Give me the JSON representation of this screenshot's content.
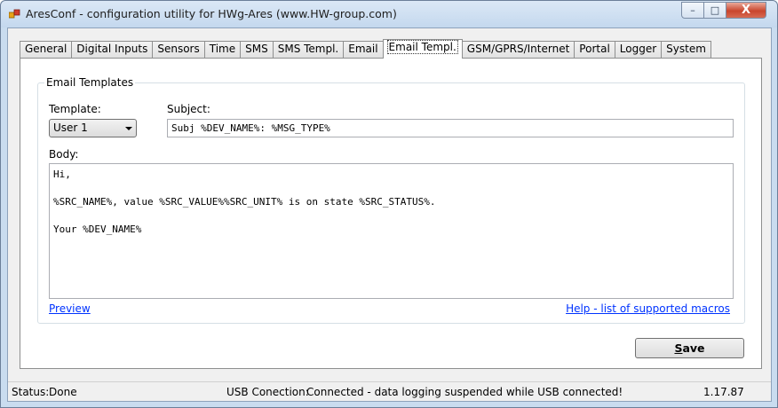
{
  "window": {
    "title": "AresConf - configuration utility for HWg-Ares (www.HW-group.com)",
    "controls": {
      "minimize": "–",
      "maximize": "□",
      "close": "X"
    }
  },
  "tabs": [
    {
      "label": "General"
    },
    {
      "label": "Digital Inputs"
    },
    {
      "label": "Sensors"
    },
    {
      "label": "Time"
    },
    {
      "label": "SMS"
    },
    {
      "label": "SMS Templ."
    },
    {
      "label": "Email"
    },
    {
      "label": "Email Templ.",
      "active": true
    },
    {
      "label": "GSM/GPRS/Internet"
    },
    {
      "label": "Portal"
    },
    {
      "label": "Logger"
    },
    {
      "label": "System"
    }
  ],
  "group": {
    "title": "Email Templates",
    "template_label": "Template:",
    "template_value": "User 1",
    "subject_label": "Subject:",
    "subject_value": "Subj %DEV_NAME%: %MSG_TYPE%",
    "body_label": "Body:",
    "body_value": "Hi,\n\n%SRC_NAME%, value %SRC_VALUE%%SRC_UNIT% is on state %SRC_STATUS%.\n\nYour %DEV_NAME%",
    "preview_link": "Preview",
    "help_link": "Help - list of supported macros"
  },
  "save_button": {
    "label_prefix": "",
    "label_underlined": "S",
    "label_rest": "ave"
  },
  "statusbar": {
    "status_label": "Status:",
    "status_value": "Done",
    "usb_label": "USB Conection:",
    "usb_value": "Connected - data logging suspended while USB connected!",
    "version": "1.17.87"
  },
  "colors": {
    "titlebar": "#c4d8ee",
    "close_button": "#c9452d",
    "link": "#0033ff"
  }
}
